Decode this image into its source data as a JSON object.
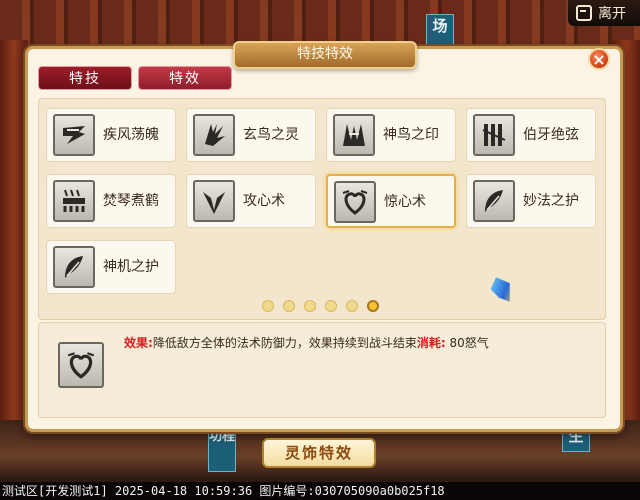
{
  "background": {
    "banner_top": "场",
    "banner_bottom_left": "功程",
    "banner_bottom_right": "生"
  },
  "leave_button": {
    "label": "离开"
  },
  "panel": {
    "title": "特技特效",
    "close": "×",
    "tabs": [
      {
        "label": "特技",
        "active": true
      },
      {
        "label": "特效",
        "active": false
      }
    ],
    "skills": [
      {
        "name": "疾风荡魄",
        "icon": "wind-rune-icon",
        "selected": false
      },
      {
        "name": "玄鸟之灵",
        "icon": "bird-spirit-icon",
        "selected": false
      },
      {
        "name": "神鸟之印",
        "icon": "divine-bird-seal-icon",
        "selected": false
      },
      {
        "name": "伯牙绝弦",
        "icon": "string-rune-icon",
        "selected": false
      },
      {
        "name": "焚琴煮鹤",
        "icon": "burning-qin-icon",
        "selected": false
      },
      {
        "name": "攻心术",
        "icon": "attack-heart-icon",
        "selected": false
      },
      {
        "name": "惊心术",
        "icon": "startle-heart-icon",
        "selected": true
      },
      {
        "name": "妙法之护",
        "icon": "feather-shield-icon",
        "selected": false
      },
      {
        "name": "神机之护",
        "icon": "feather-shield-icon",
        "selected": false
      }
    ],
    "pager": {
      "count": 6,
      "current": 6
    },
    "effect": {
      "icon": "startle-heart-icon",
      "effect_label": "效果:",
      "effect_text": "降低敌方全体的法术防御力，效果持续到战斗结束",
      "cost_label": "消耗:",
      "cost_text": "80怒气"
    }
  },
  "ornament_button": {
    "label": "灵饰特效"
  },
  "status_bar": {
    "text": "测试区[开发测试1] 2025-04-18 10:59:36 图片编号:030705090a0b025f18"
  }
}
